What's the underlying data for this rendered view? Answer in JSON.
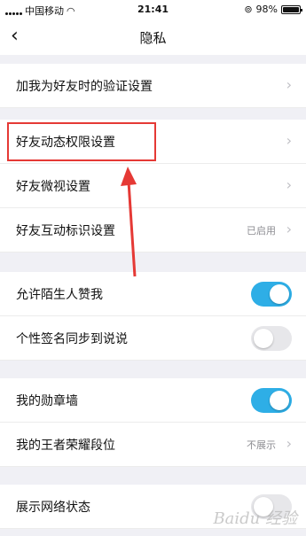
{
  "status_bar": {
    "carrier": "中国移动",
    "time": "21:41",
    "battery_percent": "98%",
    "battery_level": 0.98
  },
  "nav": {
    "title": "隐私"
  },
  "settings": {
    "friend_verification": {
      "label": "加我为好友时的验证设置"
    },
    "friend_feed_permission": {
      "label": "好友动态权限设置"
    },
    "friend_weishi": {
      "label": "好友微视设置"
    },
    "friend_interaction_badge": {
      "label": "好友互动标识设置",
      "value": "已启用"
    },
    "allow_stranger_likes": {
      "label": "允许陌生人赞我",
      "enabled": true
    },
    "signature_sync": {
      "label": "个性签名同步到说说",
      "enabled": false
    },
    "medal_wall": {
      "label": "我的勋章墙",
      "enabled": true
    },
    "king_glory_rank": {
      "label": "我的王者荣耀段位",
      "value": "不展示"
    },
    "show_network_status": {
      "label": "展示网络状态",
      "enabled": false
    }
  },
  "colors": {
    "toggle_on": "#2eaee6",
    "annotation_red": "#e53935",
    "background": "#f0f0f5"
  },
  "watermark": "Baidu 经验"
}
